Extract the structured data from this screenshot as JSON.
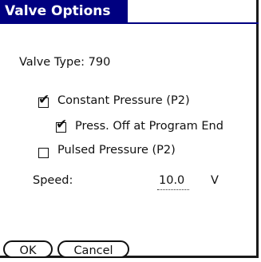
{
  "dialog": {
    "title": "Valve Options"
  },
  "valve_type": {
    "label": "Valve Type: 790"
  },
  "options": [
    {
      "label": "Constant Pressure (P2)",
      "checked": true
    },
    {
      "label": "Press. Off at Program End",
      "checked": true
    },
    {
      "label": "Pulsed Pressure (P2)",
      "checked": false
    }
  ],
  "speed": {
    "label": "Speed:",
    "value": "10.0",
    "unit": "V"
  },
  "buttons": {
    "ok": "OK",
    "cancel": "Cancel"
  }
}
